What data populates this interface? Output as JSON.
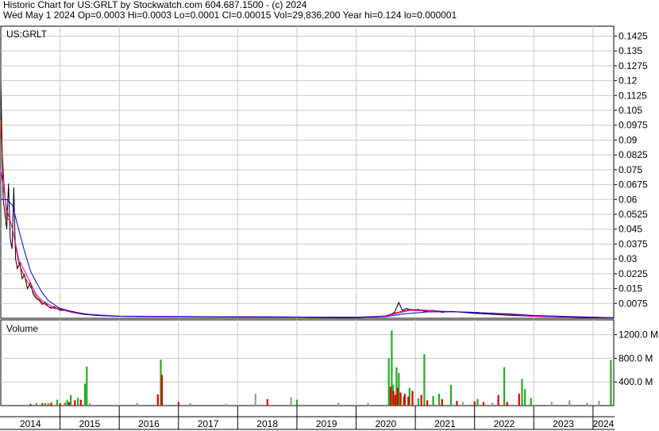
{
  "header": {
    "line1": "Historic Chart for US:GRLT by Stockwatch.com 604.687.1500 - (c) 2024",
    "line2": "Wed May  1 2024   Op=0.0003   Hi=0.0003   Lo=0.0001   Cl=0.00015   Vol=29,836,200   Year hi=0.124   lo=0.000001"
  },
  "colors": {
    "background": "#ffffff",
    "grid": "#c8c8c8",
    "price": "#000000",
    "ma_short": "#cc0000",
    "ma_mid": "#cc00cc",
    "ma_long": "#0000cc",
    "vol_up": "#22aa22",
    "vol_down": "#dd0000",
    "vol_neutral": "#999999"
  },
  "chart_data": [
    {
      "type": "line",
      "title": "US:GRLT",
      "ylim": [
        0,
        0.1475
      ],
      "y_ticks": [
        "0.1425",
        "0.135",
        "0.1275",
        "0.12",
        "0.1125",
        "0.105",
        "0.0975",
        "0.09",
        "0.0825",
        "0.075",
        "0.0675",
        "0.06",
        "0.0525",
        "0.045",
        "0.0375",
        "0.03",
        "0.0225",
        "0.015",
        "0.0075"
      ],
      "x_labels": [
        "2014",
        "2015",
        "2016",
        "2017",
        "2018",
        "2019",
        "2020",
        "2021",
        "2022",
        "2023",
        "2024"
      ],
      "x_range": [
        2014.0,
        2024.35
      ],
      "series": [
        {
          "role": "price",
          "x": [
            2014.0,
            2014.02,
            2014.04,
            2014.06,
            2014.08,
            2014.1,
            2014.13,
            2014.16,
            2014.19,
            2014.22,
            2014.25,
            2014.28,
            2014.32,
            2014.36,
            2014.4,
            2014.45,
            2014.5,
            2014.55,
            2014.6,
            2014.65,
            2014.7,
            2014.75,
            2014.8,
            2014.85,
            2014.9,
            2014.95,
            2015.0,
            2015.1,
            2015.2,
            2015.4,
            2015.6,
            2016.0,
            2017.0,
            2018.0,
            2019.0,
            2020.0,
            2020.4,
            2020.55,
            2020.65,
            2020.72,
            2020.78,
            2020.85,
            2020.95,
            2021.05,
            2021.15,
            2021.3,
            2021.45,
            2021.6,
            2021.8,
            2022.0,
            2022.3,
            2022.6,
            2023.0,
            2024.0,
            2024.35
          ],
          "y": [
            0.12,
            0.09,
            0.06,
            0.055,
            0.05,
            0.045,
            0.068,
            0.04,
            0.035,
            0.066,
            0.03,
            0.025,
            0.028,
            0.02,
            0.022,
            0.015,
            0.018,
            0.012,
            0.01,
            0.009,
            0.007,
            0.008,
            0.006,
            0.005,
            0.006,
            0.005,
            0.004,
            0.004,
            0.003,
            0.002,
            0.0015,
            0.001,
            0.0008,
            0.0007,
            0.0006,
            0.0005,
            0.0008,
            0.0015,
            0.003,
            0.008,
            0.004,
            0.005,
            0.004,
            0.0045,
            0.0035,
            0.004,
            0.003,
            0.0035,
            0.003,
            0.0025,
            0.002,
            0.0015,
            0.001,
            0.0003,
            0.00015
          ]
        },
        {
          "role": "ma-short",
          "x": [
            2014.0,
            2014.05,
            2014.1,
            2014.15,
            2014.2,
            2014.3,
            2014.4,
            2014.5,
            2014.6,
            2014.7,
            2014.8,
            2014.9,
            2015.0,
            2015.2,
            2015.5,
            2016.0,
            2020.0,
            2020.5,
            2020.7,
            2020.9,
            2021.2,
            2021.5,
            2022.0,
            2022.6,
            2023.0,
            2024.35
          ],
          "y": [
            0.1,
            0.07,
            0.05,
            0.05,
            0.045,
            0.028,
            0.021,
            0.016,
            0.011,
            0.008,
            0.006,
            0.005,
            0.0045,
            0.003,
            0.0018,
            0.001,
            0.0005,
            0.0012,
            0.003,
            0.0045,
            0.004,
            0.0035,
            0.003,
            0.0018,
            0.001,
            0.0002
          ]
        },
        {
          "role": "ma-mid",
          "x": [
            2014.0,
            2014.1,
            2014.2,
            2014.3,
            2014.4,
            2014.5,
            2014.6,
            2014.7,
            2014.8,
            2014.9,
            2015.0,
            2015.2,
            2015.5,
            2016.0,
            2020.0,
            2020.5,
            2020.7,
            2020.9,
            2021.2,
            2021.5,
            2022.0,
            2022.6,
            2023.0,
            2024.35
          ],
          "y": [
            0.075,
            0.055,
            0.045,
            0.03,
            0.024,
            0.018,
            0.012,
            0.009,
            0.007,
            0.0055,
            0.0048,
            0.0032,
            0.002,
            0.0011,
            0.0005,
            0.0011,
            0.0025,
            0.004,
            0.0038,
            0.0034,
            0.003,
            0.002,
            0.0011,
            0.0002
          ]
        },
        {
          "role": "ma-long",
          "x": [
            2014.0,
            2014.1,
            2014.2,
            2014.3,
            2014.4,
            2014.5,
            2014.6,
            2014.7,
            2014.8,
            2014.9,
            2015.0,
            2015.2,
            2015.4,
            2015.6,
            2016.0,
            2020.0,
            2020.5,
            2020.8,
            2021.2,
            2021.6,
            2022.0,
            2022.6,
            2023.0,
            2024.35
          ],
          "y": [
            0.06,
            0.06,
            0.057,
            0.045,
            0.034,
            0.024,
            0.018,
            0.013,
            0.009,
            0.007,
            0.005,
            0.0035,
            0.0022,
            0.0015,
            0.001,
            0.0005,
            0.0008,
            0.0022,
            0.0032,
            0.0033,
            0.0029,
            0.0022,
            0.0014,
            0.0003
          ]
        }
      ]
    },
    {
      "type": "bar",
      "title": "Volume",
      "ylim": [
        0,
        1450
      ],
      "y_ticks": [
        "1200.0 M",
        "800.0 M",
        "400.0 M"
      ],
      "series": [
        {
          "name": "up",
          "x": [
            2014.6,
            2014.75,
            2014.8,
            2014.95,
            2015.08,
            2015.12,
            2015.18,
            2015.3,
            2015.42,
            2015.45,
            2016.7,
            2019.0,
            2020.55,
            2020.6,
            2020.62,
            2020.68,
            2020.72,
            2020.8,
            2020.9,
            2021.05,
            2021.15,
            2021.3,
            2021.4,
            2021.6,
            2022.05,
            2022.5,
            2022.8,
            2022.85,
            2022.95,
            2024.3
          ],
          "values": [
            40,
            40,
            40,
            100,
            50,
            100,
            180,
            130,
            370,
            660,
            780,
            100,
            800,
            1270,
            350,
            650,
            550,
            150,
            300,
            120,
            870,
            160,
            200,
            350,
            110,
            650,
            450,
            280,
            130,
            770
          ]
        },
        {
          "name": "down",
          "x": [
            2014.5,
            2014.7,
            2014.85,
            2015.0,
            2015.15,
            2015.25,
            2015.35,
            2016.65,
            2016.72,
            2017.0,
            2018.5,
            2020.58,
            2020.63,
            2020.66,
            2020.7,
            2020.75,
            2020.82,
            2020.88,
            2020.95,
            2021.1,
            2021.2,
            2021.45,
            2021.7,
            2022.0,
            2022.15,
            2022.4,
            2022.55,
            2022.75
          ],
          "values": [
            30,
            40,
            50,
            40,
            60,
            90,
            100,
            190,
            520,
            60,
            110,
            320,
            250,
            180,
            300,
            220,
            200,
            150,
            250,
            180,
            90,
            110,
            80,
            70,
            60,
            180,
            60,
            200
          ]
        },
        {
          "name": "neutral",
          "x": [
            2015.5,
            2016.3,
            2017.2,
            2017.8,
            2018.3,
            2018.9,
            2019.7,
            2020.2,
            2021.8,
            2022.3,
            2023.3,
            2023.6,
            2023.9,
            2024.1
          ],
          "values": [
            40,
            50,
            40,
            30,
            200,
            140,
            50,
            50,
            60,
            50,
            60,
            90,
            50,
            80
          ]
        }
      ]
    }
  ]
}
